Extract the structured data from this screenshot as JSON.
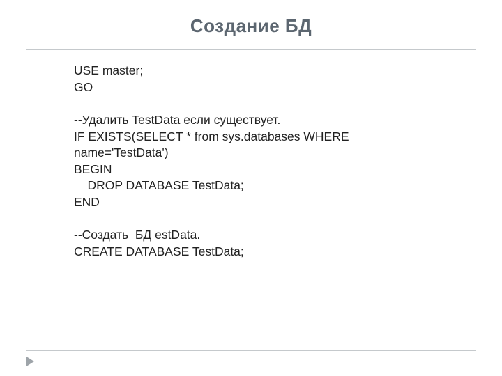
{
  "slide": {
    "title": "Создание БД",
    "code": "USE master;\nGO\n\n--Удалить TestData если существует.\nIF EXISTS(SELECT * from sys.databases WHERE name='TestData')\nBEGIN\n    DROP DATABASE TestData;\nEND\n\n--Создать  БД estData.\nCREATE DATABASE TestData;"
  }
}
